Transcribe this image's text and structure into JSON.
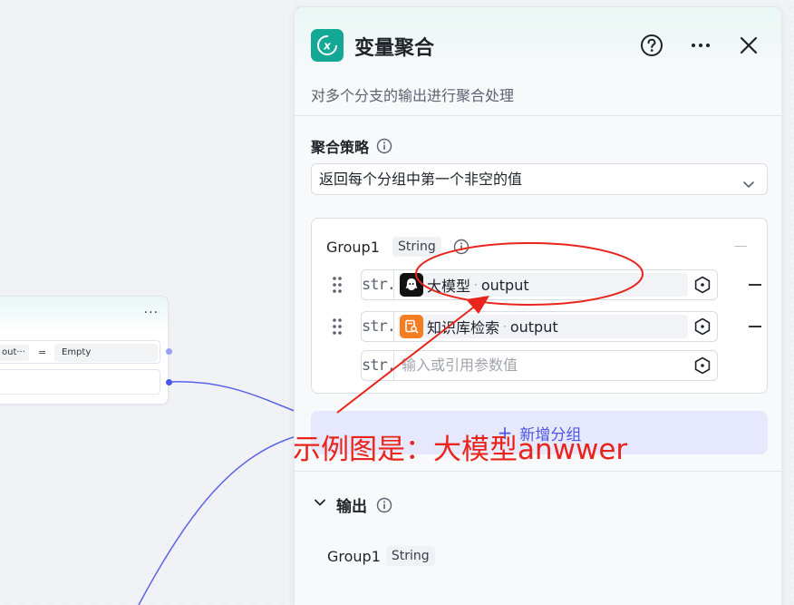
{
  "canvas_node": {
    "left_chip": "out···",
    "operator": "=",
    "value": "Empty",
    "more": "···"
  },
  "panel": {
    "title": "变量聚合",
    "description": "对多个分支的输出进行聚合处理",
    "strategy_label": "聚合策略",
    "strategy_value": "返回每个分组中第一个非空的值",
    "group": {
      "name": "Group1",
      "type": "String",
      "vars": [
        {
          "type_label": "str.",
          "source": "大模型",
          "sep": "·",
          "field": "output",
          "icon": "llm-icon"
        },
        {
          "type_label": "str.",
          "source": "知识库检索",
          "sep": "·",
          "field": "output",
          "icon": "knowledge-icon"
        }
      ],
      "empty_input": {
        "type_label": "str.",
        "placeholder": "输入或引用参数值"
      }
    },
    "add_group_label": "新增分组",
    "add_group_plus": "+",
    "output": {
      "label": "输出",
      "items": [
        {
          "name": "Group1",
          "type": "String"
        }
      ]
    }
  },
  "annotation": {
    "text": "示例图是：大模型anwwer",
    "color": "#e8241c"
  },
  "colors": {
    "accent": "#4d53e8",
    "node_icon": "#12a895",
    "knowledge_icon": "#f57c22"
  }
}
